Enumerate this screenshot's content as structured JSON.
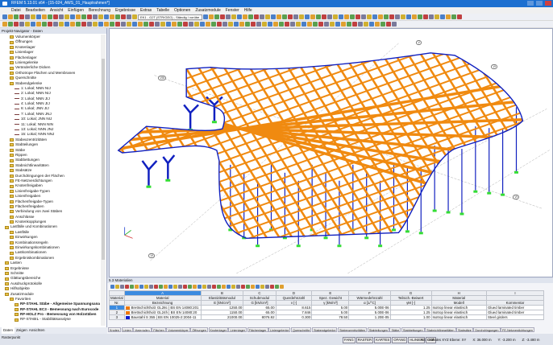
{
  "title": "RFEM 5.13.01 x64 - [15-024_AWS_01_Hauptrahmen*]",
  "menu": [
    "Datei",
    "Bearbeiten",
    "Ansicht",
    "Einfügen",
    "Berechnung",
    "Ergebnisse",
    "Extras",
    "Tabelle",
    "Optionen",
    "Zusatzmodule",
    "Fenster",
    "Hilfe"
  ],
  "toolbar": {
    "loadcase_combo": "EK1 - G2T (STR/GEO) - Ständig / vorübe"
  },
  "navigator": {
    "title": "Projekt-Navigator - Daten",
    "items": [
      "Volumenkörper",
      "Öffnungen",
      "Knotenlager",
      "Linienlager",
      "Flächenlager",
      "Liniengelenke",
      "Veränderliche Dicken",
      "Orthotrope Flächen und Membranen",
      "Querschnitte",
      "Stabendgelenke",
      "1: Lokal; NNN NIJ",
      "2: Lokal; NNN NIJ",
      "3: Lokal; NNN JIJ",
      "4: Lokal; NNN JIJ",
      "6: Lokal; JNN JIJ",
      "7: Lokal; NNN JNJ",
      "10: Lokal; JNN NIJ",
      "11: Lokal; NNN NIN",
      "13: Lokal; NNN JNJ",
      "15: Lokal; NNN NNJ",
      "Stabexzentrizitäten",
      "Stabteilungen",
      "Stäbe",
      "Rippen",
      "Stabbettungen",
      "Stabnichtlinearitäten",
      "Stabsätze",
      "Durchdringungen der Flächen",
      "FE-Netzverdichtungen",
      "Knotenfreigaben",
      "Linienfreigabe-Typen",
      "Linienfreigaben",
      "Flächenfreigabe-Typen",
      "Flächenfreigaben",
      "Verbindung von zwei Stäben",
      "Anschlüsse",
      "Knotenkopplungen",
      "Lastfälle und Kombinationen",
      "Lastfälle",
      "Einwirkungen",
      "Kombinationsregeln",
      "Einwirkungskombinationen",
      "Lastkombinationen",
      "Ergebniskombinationen",
      "Lasten",
      "Ergebnisse",
      "Schnitte",
      "Glättungsbereiche",
      "Ausdruckprotokolle",
      "Hilfsobjekte",
      "Zusatzmodule",
      "Favoriten",
      "RF-STAHL Stäbe - Allgemeine Spannungsanalyse",
      "RF-STAHL EC3 - Bemessung nach Eurocode 3",
      "RF-HOLZ Pro - Bemessung von Holzstäben",
      "RF-STABIL - Stabilitätsanalyse"
    ],
    "tabs": [
      "Daten",
      "Zeigen",
      "Ansichten"
    ]
  },
  "view": {
    "axis_labels": [
      "V",
      "VI",
      "VIII",
      "VI",
      "VI"
    ]
  },
  "panel": {
    "title": "5.3 Materialien",
    "col_letters": [
      "A",
      "B",
      "C",
      "D",
      "E",
      "F",
      "G",
      "H",
      "I"
    ],
    "headers1": [
      "Material",
      "Material",
      "Elastizitätsmodul",
      "Schubmodul",
      "Querdehnzahl",
      "Spez. Gewicht",
      "Wärmedehnzahl",
      "Teilsich.-Beiwert",
      "Material",
      ""
    ],
    "headers2": [
      "Nr.",
      "Bezeichnung",
      "E [kN/cm²]",
      "G [kN/cm²]",
      "ν [-]",
      "γ [kN/m³]",
      "α [1/°C]",
      "γM [-]",
      "Modell",
      "Kommentar"
    ],
    "rows": [
      {
        "nr": "1",
        "name": "Brettschichtholz GL28c | BS EN 14080:201",
        "color": "#f07800",
        "e": "1250.00",
        "g": "65.00",
        "nu": "8.615",
        "gamma": "5.00",
        "alpha": "5.00E-06",
        "gm": "1.25",
        "model": "Isotrop linear elastisch",
        "comment": "Glued laminated timber"
      },
      {
        "nr": "2",
        "name": "Brettschichtholz GL24h | BS EN 14080:20",
        "color": "#f07800",
        "e": "1150.00",
        "g": "65.00",
        "nu": "7.846",
        "gamma": "5.00",
        "alpha": "5.00E-06",
        "gm": "1.25",
        "model": "Isotrop linear elastisch",
        "comment": "Glued laminated timber"
      },
      {
        "nr": "3",
        "name": "Baustahl S 355 | BS EN 10025-2:2004-11",
        "color": "#0a1ad0",
        "e": "21000.00",
        "g": "8076.92",
        "nu": "0.300",
        "gamma": "78.50",
        "alpha": "1.20E-05",
        "gm": "1.00",
        "model": "Isotrop linear elastisch",
        "comment": "Steel girders"
      }
    ],
    "tabs": [
      "Knoten",
      "Linien",
      "Materialien",
      "Flächen",
      "Volumenkörper",
      "Öffnungen",
      "Knotenlager",
      "Linienlager",
      "Flächenlager",
      "Liniengelenke",
      "Querschnitte",
      "Stabendgelenke",
      "Stabexzentrizitäten",
      "Stabteilungen",
      "Stäbe",
      "Stabbettungen",
      "Stabnichtlinearitäten",
      "Stabsätze",
      "Durchdringungen",
      "FE-Netzverdichtungen"
    ],
    "active_tab": 2
  },
  "status": {
    "left": "Rasterpunkt",
    "modes": [
      "FANG",
      "RASTER",
      "KARTES",
      "OFANG",
      "HLINIEN",
      "DXF"
    ],
    "cs": "KS: Globales XYZ Ebene: XY",
    "x": "X: 36.000 m",
    "y": "Y: -3.200 m",
    "z": "Z: -3.480 m"
  }
}
